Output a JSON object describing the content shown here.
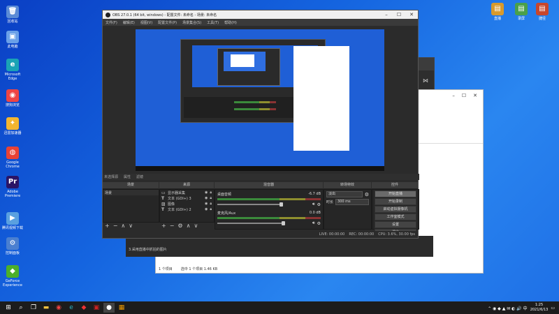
{
  "desktop": {
    "left_icons": [
      {
        "label": "回收站",
        "glyph": "🗑",
        "color": "#5b8bd6"
      },
      {
        "label": "此电脑",
        "glyph": "▣",
        "color": "#6aa0e8"
      },
      {
        "label": "Microsoft Edge",
        "glyph": "e",
        "color": "#1aa3b5"
      },
      {
        "label": "搜狗浏览",
        "glyph": "◉",
        "color": "#e44"
      },
      {
        "label": "迅雷加速器",
        "glyph": "✦",
        "color": "#f2b530"
      },
      {
        "label": "Google Chrome",
        "glyph": "◍",
        "color": "#e94235"
      },
      {
        "label": "Adobe Premiere",
        "glyph": "Pr",
        "color": "#2a1466"
      },
      {
        "label": "腾讯视频下载",
        "glyph": "▶",
        "color": "#5aa0e0"
      },
      {
        "label": "控制面板",
        "glyph": "⚙",
        "color": "#4a7fd0"
      },
      {
        "label": "GeForce Experience",
        "glyph": "◆",
        "color": "#4caf2a"
      }
    ],
    "right_icons": [
      {
        "label": "直播",
        "glyph": "▤",
        "color": "#d89a2c"
      },
      {
        "label": "录屏",
        "glyph": "▤",
        "color": "#4aa04a"
      },
      {
        "label": "捷径",
        "glyph": "▤",
        "color": "#c8462c"
      }
    ]
  },
  "obs": {
    "title": "OBS 27.0.1 (64 bit, windows) - 配置文件: 未命名 - 场景: 未命名",
    "menu": [
      "文件(F)",
      "编辑(E)",
      "视图(V)",
      "配置文件(P)",
      "场景集合(S)",
      "工具(T)",
      "帮助(H)"
    ],
    "selected_source": "未选择源",
    "toolbar_props": "属性",
    "toolbar_filters": "滤镜",
    "docks": {
      "scenes": "场景",
      "sources": "来源",
      "mixer": "混音器",
      "transitions": "转场特效",
      "controls": "控件"
    },
    "scenes": [
      "场景"
    ],
    "sources": [
      {
        "icon": "▭",
        "name": "显示器采集"
      },
      {
        "icon": "T",
        "name": "文本 (GDI+) 3"
      },
      {
        "icon": "▨",
        "name": "图像"
      },
      {
        "icon": "T",
        "name": "文本 (GDI+) 2"
      }
    ],
    "mixer": [
      {
        "name": "桌面音频",
        "db": "-6.7 dB",
        "fill": 0.8
      },
      {
        "name": "麦克风/Aux",
        "db": "0.0 dB",
        "fill": 0.82
      }
    ],
    "transition": {
      "type": "淡出",
      "duration_label": "时长",
      "duration": "300 ms"
    },
    "controls": [
      "开始直播",
      "开始录制",
      "启动虚拟摄像机",
      "工作室模式",
      "设置",
      "退出"
    ],
    "status": {
      "live": "LIVE: 00:00:00",
      "rec": "REC: 00:00:00",
      "cpu": "CPU: 3.6%, 30.00 fps"
    }
  },
  "explorer": {
    "status_left": "1 个项目",
    "status_mid": "选中 1 个项目  1.46 KB",
    "bottom_text": "3.采用直播中抓拍的图片"
  },
  "taskbar": {
    "time": "1:25",
    "date": "2021/6/13"
  }
}
